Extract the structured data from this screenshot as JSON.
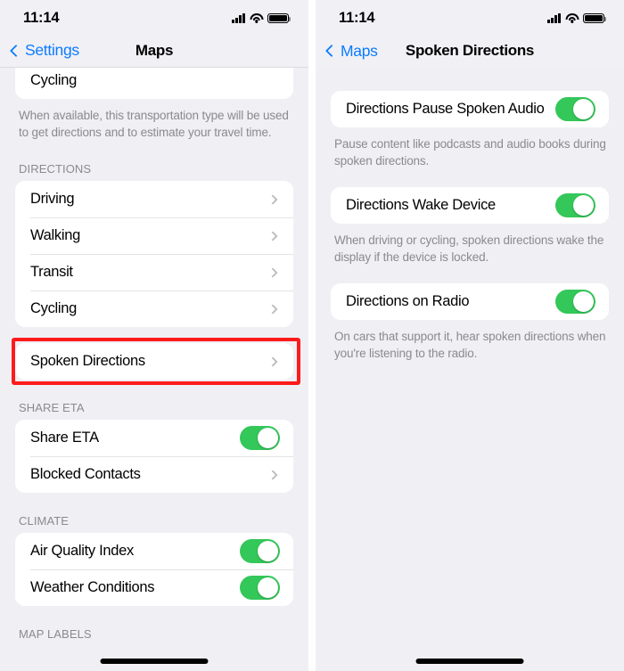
{
  "theme": {
    "accent_blue": "#0a7cff",
    "toggle_green": "#34c759",
    "highlight_red": "#fc1b1b",
    "page_background": "#f0eff4",
    "card_background": "#ffffff",
    "secondary_text": "#8a8a8f"
  },
  "left_panel": {
    "status_bar": {
      "time": "11:14"
    },
    "nav": {
      "back_label": "Settings",
      "title": "Maps"
    },
    "partial_card_top": {
      "rows": [
        {
          "label": "Cycling"
        }
      ]
    },
    "transport_footnote": "When available, this transportation type will be used to get directions and to estimate your travel time.",
    "directions_section": {
      "header": "DIRECTIONS",
      "rows": [
        {
          "label": "Driving",
          "accessory": "chevron"
        },
        {
          "label": "Walking",
          "accessory": "chevron"
        },
        {
          "label": "Transit",
          "accessory": "chevron"
        },
        {
          "label": "Cycling",
          "accessory": "chevron"
        }
      ]
    },
    "spoken_directions_row": {
      "label": "Spoken Directions",
      "accessory": "chevron",
      "highlighted": true
    },
    "share_eta_section": {
      "header": "SHARE ETA",
      "rows": [
        {
          "label": "Share ETA",
          "accessory": "toggle",
          "value": "on"
        },
        {
          "label": "Blocked Contacts",
          "accessory": "chevron"
        }
      ]
    },
    "climate_section": {
      "header": "CLIMATE",
      "rows": [
        {
          "label": "Air Quality Index",
          "accessory": "toggle",
          "value": "on"
        },
        {
          "label": "Weather Conditions",
          "accessory": "toggle",
          "value": "on"
        }
      ]
    },
    "map_labels_section": {
      "header": "MAP LABELS"
    }
  },
  "right_panel": {
    "status_bar": {
      "time": "11:14"
    },
    "nav": {
      "back_label": "Maps",
      "title": "Spoken Directions"
    },
    "groups": [
      {
        "row": {
          "label": "Directions Pause Spoken Audio",
          "accessory": "toggle",
          "value": "on"
        },
        "footnote": "Pause content like podcasts and audio books during spoken directions."
      },
      {
        "row": {
          "label": "Directions Wake Device",
          "accessory": "toggle",
          "value": "on"
        },
        "footnote": "When driving or cycling, spoken directions wake the display if the device is locked."
      },
      {
        "row": {
          "label": "Directions on Radio",
          "accessory": "toggle",
          "value": "on"
        },
        "footnote": "On cars that support it, hear spoken directions when you're listening to the radio."
      }
    ]
  }
}
